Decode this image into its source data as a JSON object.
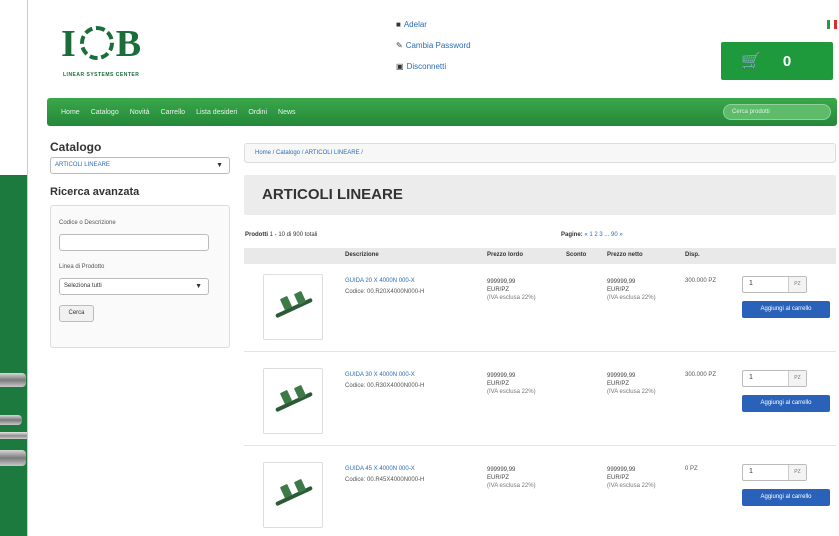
{
  "brand": {
    "logo_text": "ISB",
    "tagline": "LINEAR SYSTEMS CENTER"
  },
  "user_links": [
    {
      "icon": "user-icon",
      "label": "Adelar"
    },
    {
      "icon": "pencil-icon",
      "label": "Cambia Password"
    },
    {
      "icon": "logout-icon",
      "label": "Disconnetti"
    }
  ],
  "cart": {
    "icon": "cart-icon",
    "count": "0"
  },
  "nav": {
    "items": [
      "Home",
      "Catalogo",
      "Novità",
      "Carrello",
      "Lista desideri",
      "Ordini",
      "News"
    ],
    "search_placeholder": "Cerca prodotti"
  },
  "sidebar": {
    "catalog_title": "Catalogo",
    "catalog_selected": "ARTICOLI LINEARE",
    "advanced_title": "Ricerca avanzata",
    "code_label": "Codice o Descrizione",
    "code_value": "",
    "line_label": "Linea di Prodotto",
    "line_selected": "Seleziona tutti",
    "search_button": "Cerca"
  },
  "breadcrumb": "Home / Catalogo / ARTICOLI LINEARE /",
  "page_title": "ARTICOLI LINEARE",
  "results": {
    "prefix": "Prodotti",
    "text": "1 - 10 di 900 totali",
    "pager_label": "Pagine:",
    "pager_links": "« 1 2 3 ... 90 »"
  },
  "table": {
    "headers": {
      "description": "Descrizione",
      "gross": "Prezzo lordo",
      "discount": "Sconto",
      "net": "Prezzo netto",
      "availability": "Disp."
    },
    "rows": [
      {
        "description": "GUIDA 20 X 4000N 000-X",
        "code": "Codice: 00.R20X4000N000-H",
        "gross_price": "999999,99",
        "gross_unit": "EUR/PZ",
        "gross_iva": "(IVA esclusa 22%)",
        "net_price": "999999,99",
        "net_unit": "EUR/PZ",
        "net_iva": "(IVA esclusa 22%)",
        "availability": "300.000 PZ",
        "qty": "1",
        "unit": "PZ",
        "add_label": "Aggiungi al carrello"
      },
      {
        "description": "GUIDA 30 X 4000N 000-X",
        "code": "Codice: 00.R30X4000N000-H",
        "gross_price": "999999,99",
        "gross_unit": "EUR/PZ",
        "gross_iva": "(IVA esclusa 22%)",
        "net_price": "999999,99",
        "net_unit": "EUR/PZ",
        "net_iva": "(IVA esclusa 22%)",
        "availability": "300.000 PZ",
        "qty": "1",
        "unit": "PZ",
        "add_label": "Aggiungi al carrello"
      },
      {
        "description": "GUIDA 45 X 4000N 000-X",
        "code": "Codice: 00.R45X4000N000-H",
        "gross_price": "999999,99",
        "gross_unit": "EUR/PZ",
        "gross_iva": "(IVA esclusa 22%)",
        "net_price": "999999,99",
        "net_unit": "EUR/PZ",
        "net_iva": "(IVA esclusa 22%)",
        "availability": "0 PZ",
        "qty": "1",
        "unit": "PZ",
        "add_label": "Aggiungi al carrello"
      }
    ]
  },
  "colors": {
    "brand_green": "#1b6e3a",
    "nav_green": "#2f9a43",
    "link_blue": "#2b6db3",
    "button_blue": "#2962b8"
  }
}
